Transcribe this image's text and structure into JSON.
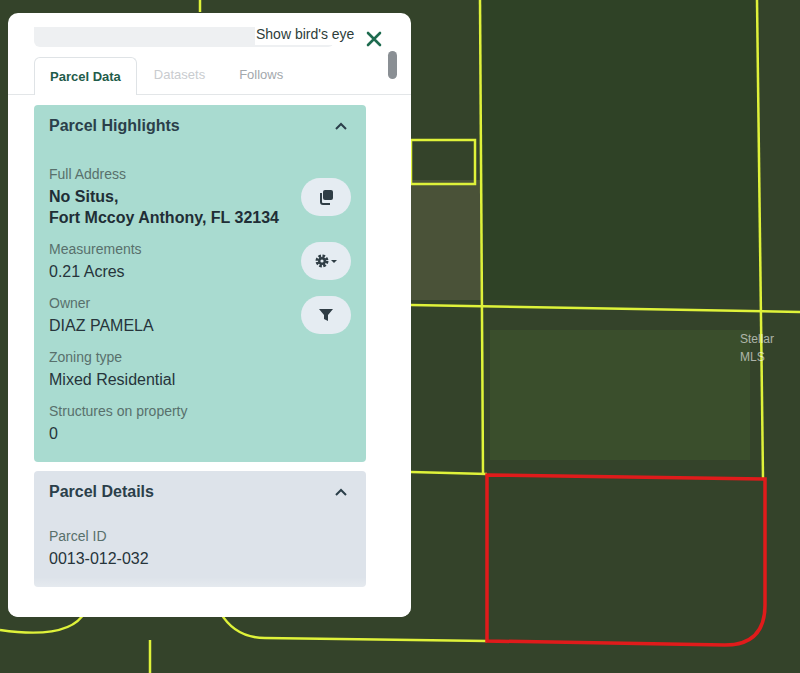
{
  "map": {
    "watermark": "Stellar MLS"
  },
  "panel": {
    "top_link": "Show bird's eye",
    "tabs": [
      {
        "label": "Parcel Data",
        "selected": true,
        "disabled": false
      },
      {
        "label": "Datasets",
        "selected": false,
        "disabled": true
      },
      {
        "label": "Follows",
        "selected": false,
        "disabled": false
      }
    ],
    "sections": [
      {
        "title": "Parcel Highlights",
        "expanded": true,
        "fields": [
          {
            "label": "Full Address",
            "lines": [
              "No Situs,",
              "Fort Mccoy Anthony, FL 32134"
            ],
            "bold": true,
            "kind": "copy"
          },
          {
            "label": "Measurements",
            "lines": [
              "0.21 Acres"
            ],
            "bold": false,
            "kind": "settings"
          },
          {
            "label": "Owner",
            "lines": [
              "DIAZ PAMELA"
            ],
            "bold": false,
            "kind": "filter"
          },
          {
            "label": "Zoning type",
            "lines": [
              "Mixed Residential"
            ],
            "bold": false,
            "kind": "plain"
          },
          {
            "label": "Structures on property",
            "lines": [
              "0"
            ],
            "bold": false,
            "kind": "plain"
          }
        ]
      },
      {
        "title": "Parcel Details",
        "expanded": true,
        "fields": [
          {
            "label": "Parcel ID",
            "lines": [
              "0013-012-032"
            ],
            "bold": false,
            "kind": "plain"
          }
        ]
      }
    ]
  }
}
